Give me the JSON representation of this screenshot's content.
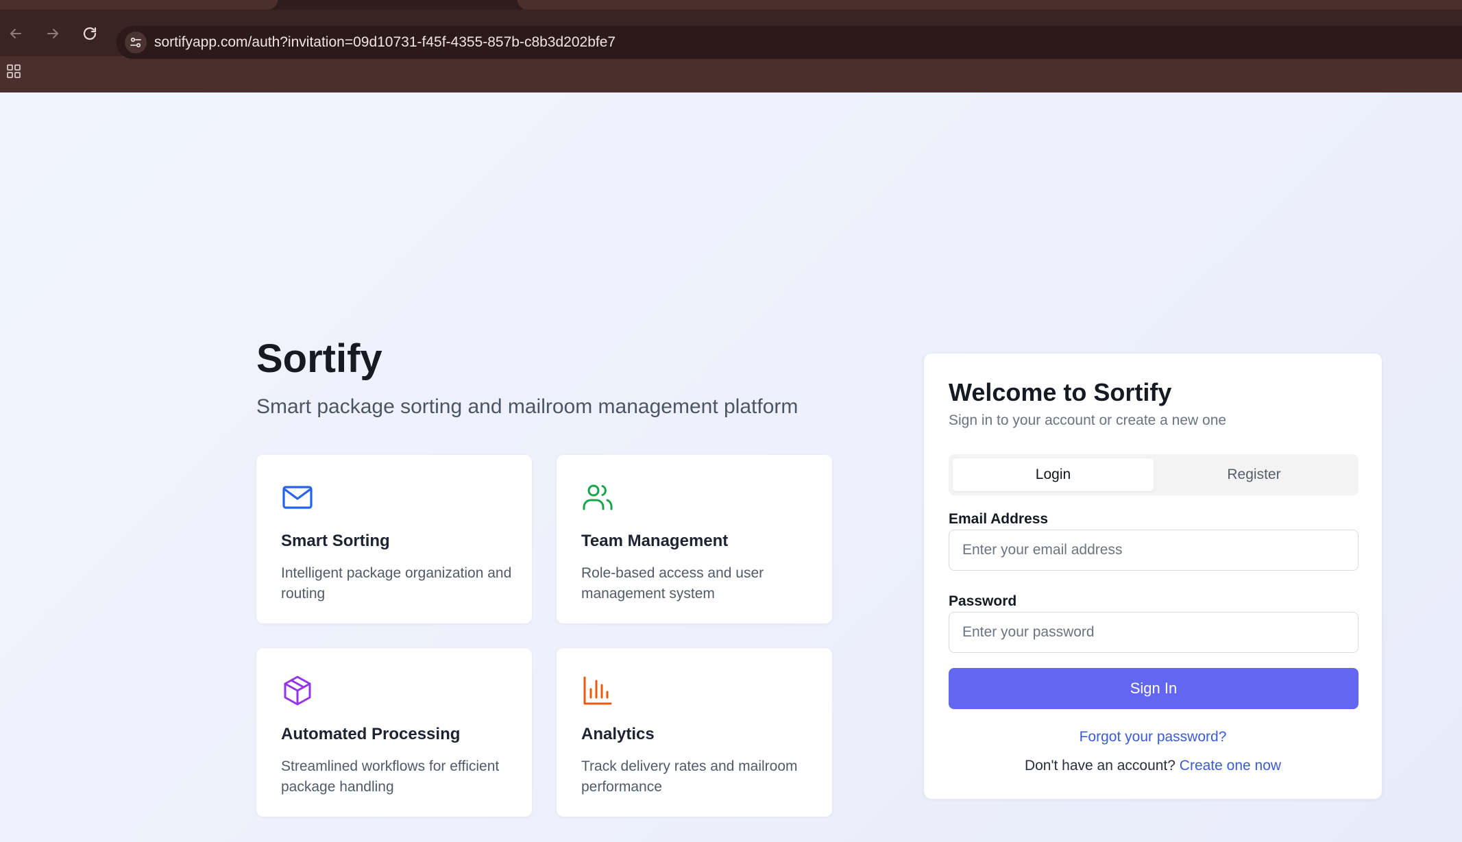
{
  "browser": {
    "url": "sortifyapp.com/auth?invitation=09d10731-f45f-4355-857b-c8b3d202bfe7",
    "icons": [
      "back-arrow-icon",
      "forward-arrow-icon",
      "reload-icon",
      "site-settings-icon",
      "apps-grid-icon"
    ]
  },
  "hero": {
    "title": "Sortify",
    "subtitle": "Smart package sorting and mailroom management platform"
  },
  "features": [
    {
      "title": "Smart Sorting",
      "description": "Intelligent package organization and routing",
      "icon": "mail-icon",
      "color": "#2563eb"
    },
    {
      "title": "Team Management",
      "description": "Role-based access and user management system",
      "icon": "users-icon",
      "color": "#16a34a"
    },
    {
      "title": "Automated Processing",
      "description": "Streamlined workflows for efficient package handling",
      "icon": "package-icon",
      "color": "#9333ea"
    },
    {
      "title": "Analytics",
      "description": "Track delivery rates and mailroom performance",
      "icon": "bar-chart-icon",
      "color": "#ea580c"
    }
  ],
  "auth": {
    "title": "Welcome to Sortify",
    "subtitle": "Sign in to your account or create a new one",
    "tabs": [
      {
        "label": "Login",
        "active": true
      },
      {
        "label": "Register",
        "active": false
      }
    ],
    "email_label": "Email Address",
    "email_placeholder": "Enter your email address",
    "email_value": "",
    "password_label": "Password",
    "password_placeholder": "Enter your password",
    "password_value": "",
    "signin_label": "Sign In",
    "forgot_link": "Forgot your password?",
    "no_account_text": "Don't have an account?",
    "create_link": "Create one now"
  },
  "colors": {
    "accent": "#6366f1",
    "link": "#3b5bd6",
    "browser_frame": "#4a302d"
  }
}
